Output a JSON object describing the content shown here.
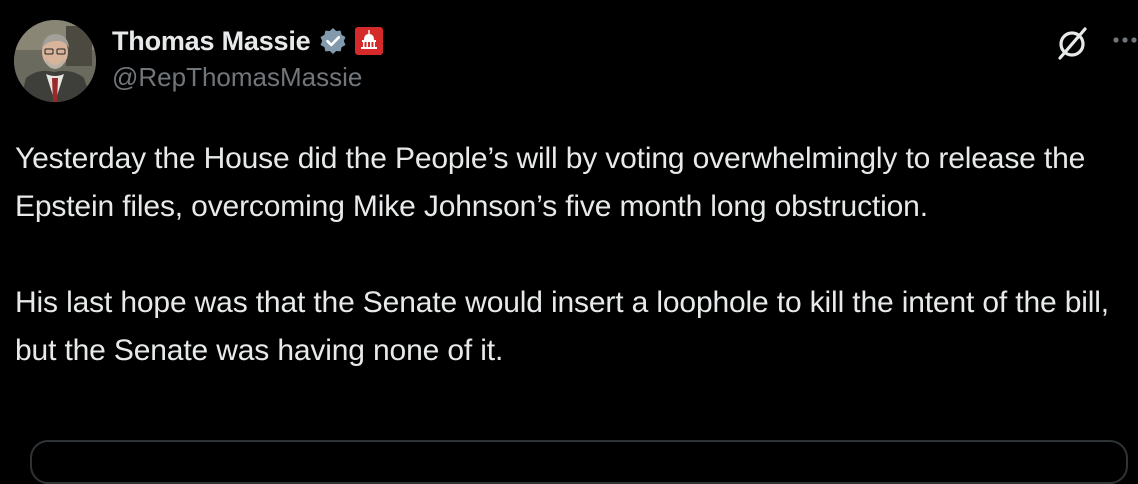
{
  "author": {
    "name": "Thomas Massie",
    "handle": "@RepThomasMassie"
  },
  "icons": {
    "verified": "verified-badge-icon",
    "affiliation": "us-capitol-affiliation-icon",
    "grok": "grok-icon",
    "more": "more-options-icon"
  },
  "colors": {
    "background": "#000000",
    "text_primary": "#e7e9ea",
    "text_secondary": "#71767b",
    "affiliation_badge": "#d42a2a",
    "verified_badge": "#829aab"
  },
  "tweet": {
    "paragraphs": [
      "Yesterday the House did the People’s will by voting overwhelmingly to release the Epstein files, overcoming Mike Johnson’s five month long obstruction.",
      "His last hope was that the Senate would insert a loophole to kill the intent of the bill, but the Senate was having none of it."
    ]
  }
}
